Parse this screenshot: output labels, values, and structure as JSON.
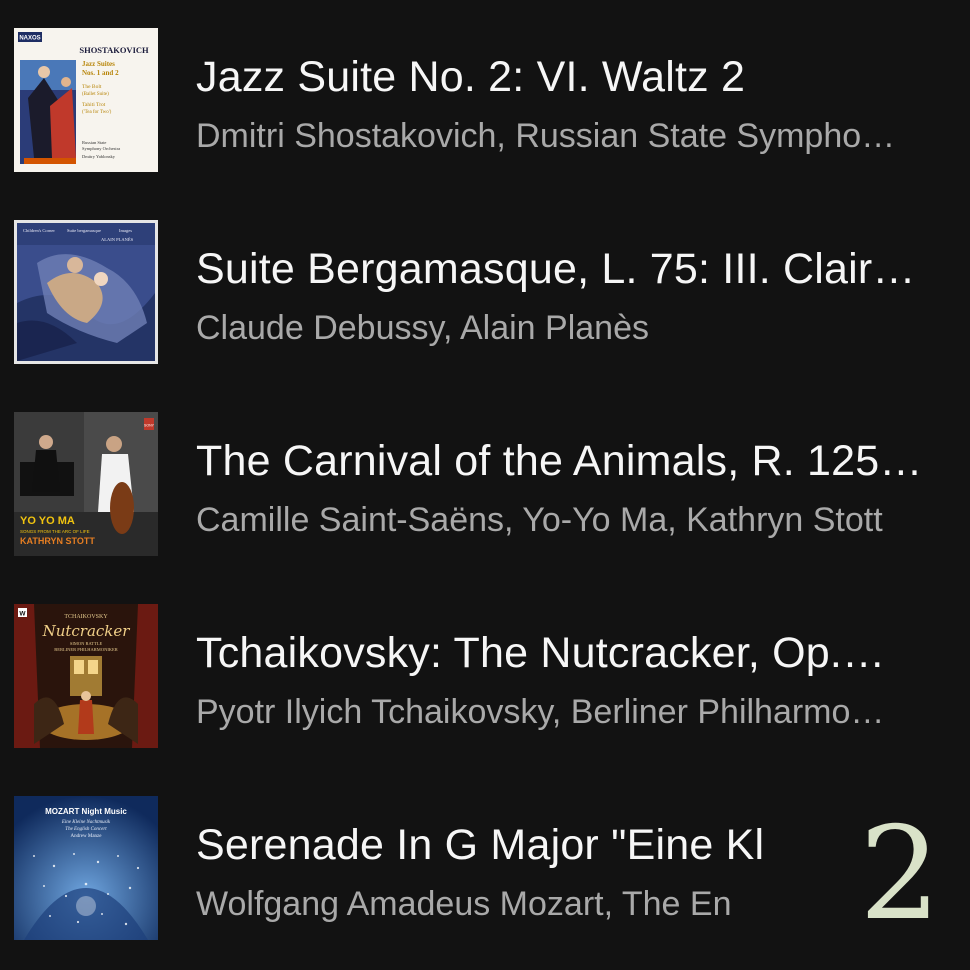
{
  "tracks": [
    {
      "title": "Jazz Suite No. 2: VI. Waltz 2",
      "artists": "Dmitri Shostakovich, Russian State Sympho…",
      "cover": {
        "brand": "NAXOS",
        "composer": "SHOSTAKOVICH",
        "lines": [
          "Jazz Suites",
          "Nos. 1 and 2",
          "The Bolt",
          "(Ballet Suite)",
          "Tahiti Trot",
          "('Tea for Two')",
          "Russian State",
          "Symphony Orchestra",
          "Dmitry Yablonsky"
        ]
      }
    },
    {
      "title": "Suite Bergamasque, L. 75: III. Clair…",
      "artists": "Claude Debussy, Alain Planès",
      "cover": {
        "lines": [
          "Children's Corner",
          "Suite bergamasque",
          "Images",
          "ALAIN PLANÈS"
        ]
      }
    },
    {
      "title": "The Carnival of the Animals, R. 125…",
      "artists": "Camille Saint-Saëns, Yo-Yo Ma, Kathryn Stott",
      "cover": {
        "label": "SONY",
        "lines": [
          "YO YO MA",
          "SONGS FROM THE ARC OF LIFE",
          "KATHRYN STOTT"
        ]
      }
    },
    {
      "title": "Tchaikovsky: The Nutcracker, Op.…",
      "artists": "Pyotr Ilyich Tchaikovsky, Berliner Philharmo…",
      "cover": {
        "label": "W",
        "lines": [
          "TCHAIKOVSKY",
          "Nutcracker",
          "SIMON RATTLE",
          "BERLINER PHILHARMONIKER"
        ]
      }
    },
    {
      "title": "Serenade In G Major \"Eine Kl",
      "artists": "Wolfgang Amadeus Mozart, The En",
      "cover": {
        "lines": [
          "MOZART Night Music",
          "Eine Kleine Nachtmusik",
          "The English Concert",
          "Andrew Manze"
        ]
      }
    }
  ],
  "page_number": "2",
  "colors": {
    "background": "#121212",
    "title": "#f6f6f6",
    "subtitle": "#a9a9a9",
    "page_number": "#d9e2c8"
  }
}
